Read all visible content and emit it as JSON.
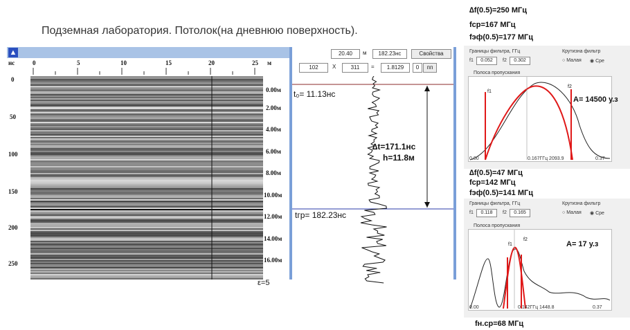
{
  "title": "Подземная лаборатория. Потолок(на дневнюю поверхность).",
  "radargram": {
    "time_unit": "нс",
    "dist_unit": "м",
    "x_ticks": [
      "0",
      "5",
      "10",
      "15",
      "20",
      "25"
    ],
    "y_ticks": [
      "0",
      "50",
      "100",
      "150",
      "200",
      "250"
    ],
    "depth_ticks": [
      "0.00м",
      "2.00м",
      "4.00м",
      "6.00м",
      "8.00м",
      "10.00м",
      "12.00м",
      "14.00м",
      "16.00м"
    ],
    "epsilon": "ε=5"
  },
  "trace_panel": {
    "field1": "20.40",
    "unit1": "м",
    "field2": "182.23нс",
    "props_button": "Свойства",
    "field3": "102",
    "x_label": "X",
    "field4": "311",
    "eq_label": "=",
    "field5": "1.8129",
    "field6": "0",
    "field7": "пп",
    "t0": "t₀= 11.13нс",
    "dt": "∆t=171.1нс",
    "h": "h=11.8м",
    "tgr": "tгр= 182.23нс"
  },
  "filter1": {
    "df": "∆f(0.5)=250 МГц",
    "fcp": "fср=167 МГц",
    "feff": "fэф(0.5)=177 МГц",
    "bounds_title": "Границы фильтра, ГГц",
    "f1_label": "f1",
    "f1_value": "0.052",
    "f2_label": "f2",
    "f2_value": "0.302",
    "steep_title": "Крутизна фильтр",
    "opt_low": "Малая",
    "opt_mid": "Сре",
    "band_title": "Полоса пропускания",
    "amp": "A= 14500 у.з",
    "mark_f1": "f1",
    "mark_f2": "f2",
    "ax0": "0.00",
    "axmid": "0.167ГГц 2093.9",
    "axend": "0.37"
  },
  "filter2": {
    "df": "∆f(0.5)=47 МГц",
    "fcp": "fср=142 МГц",
    "feff": "fэф(0.5)=141 МГц",
    "bounds_title": "Границы фильтра, ГГц",
    "f1_label": "f1",
    "f1_value": "0.118",
    "f2_label": "f2",
    "f2_value": "0.165",
    "steep_title": "Крутизна фильтр",
    "opt_low": "Малая",
    "opt_mid": "Сре",
    "band_title": "Полоса пропускания",
    "amp": "A= 17 у.з",
    "mark_f1": "f1",
    "mark_f2": "f2",
    "ax0": "0.00",
    "axmid": "0.142ГГц 1448.8",
    "axend": "0.37",
    "fnc": "fн.ср=68 МГц"
  }
}
